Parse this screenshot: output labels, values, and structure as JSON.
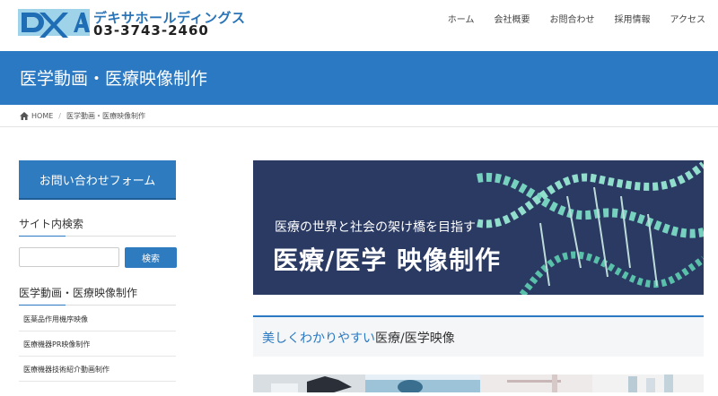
{
  "header": {
    "brand_name": "デキサホールディングス",
    "phone": "03-3743-2460",
    "nav": [
      "ホーム",
      "会社概要",
      "お問合わせ",
      "採用情報",
      "アクセス"
    ]
  },
  "page_title": "医学動画・医療映像制作",
  "breadcrumb": {
    "home": "HOME",
    "current": "医学動画・医療映像制作"
  },
  "sidebar": {
    "contact_button": "お問い合わせフォーム",
    "search_heading": "サイト内検索",
    "search_placeholder": "",
    "search_button": "検索",
    "menu_heading": "医学動画・医療映像制作",
    "menu_items": [
      "医薬品作用機序映像",
      "医療機器PR映像制作",
      "医療機器技術紹介動画制作"
    ]
  },
  "banner": {
    "subtitle": "医療の世界と社会の架け橋を目指す",
    "title": "医療/医学 映像制作"
  },
  "section": {
    "title_accent": "美しくわかりやすい",
    "title_rest": "医療/医学映像"
  },
  "colors": {
    "primary": "#2b79c2",
    "banner_bg": "#2a3a63",
    "dna": "#7fe3c9"
  }
}
